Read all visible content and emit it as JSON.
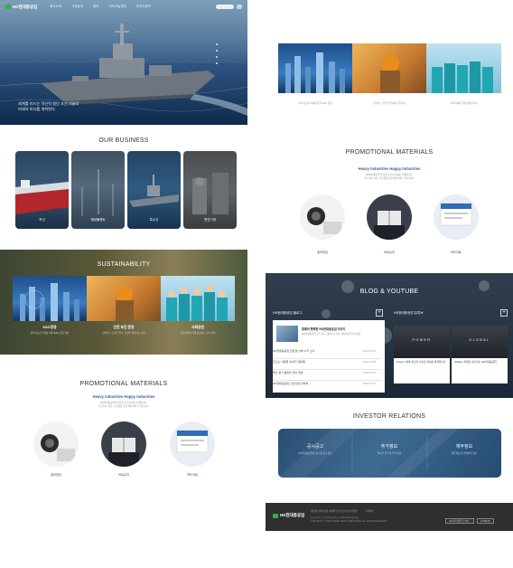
{
  "header": {
    "logo_text": "HD현대중공업",
    "menu": [
      "회사소개",
      "사업분야",
      "홍보",
      "지속가능경영",
      "투자자정보"
    ]
  },
  "hero": {
    "caption_line1": "세계를 리드는 혁신적 첨단 조선 기술로",
    "caption_line2": "미래의 바다를 개척한다"
  },
  "business": {
    "title": "OUR BUSINESS",
    "cards": [
      {
        "label": "조선"
      },
      {
        "label": "해양플랜트"
      },
      {
        "label": "특수선"
      },
      {
        "label": "엔진기계"
      }
    ]
  },
  "sustainability": {
    "title": "SUSTAINABILITY",
    "items": [
      {
        "title": "ESG경영",
        "desc": "지속가능한 미래를 위한 ESG 경영 실천"
      },
      {
        "title": "안전 보건 환경",
        "desc": "안전하고 건강한 일터, 환경을 생각하는 기업"
      },
      {
        "title": "사회공헌",
        "desc": "지역사회와 함께 성장하는 나눔 경영"
      }
    ]
  },
  "promotional": {
    "title": "PROMOTIONAL MATERIALS",
    "subtitle": "Heavy Industries Happy Industries",
    "desc_line1": "HD현대중공업의 다양한 홍보자료를 소개합니다.",
    "desc_line2": "브로슈어, 사보, 홍보영상 등을 확인하실 수 있습니다.",
    "items": [
      {
        "label": "홍보영상"
      },
      {
        "label": "브로슈어"
      },
      {
        "label": "보도자료"
      }
    ]
  },
  "right_top_images": {
    "captions": [
      "지속가능한 미래를 위한 ESG 경영",
      "안전하고 건강한 일터를 만듭니다",
      "지역사회와 함께 성장합니다"
    ]
  },
  "blog": {
    "title": "BLOG & YOUTUBE",
    "blog_head": "HD현대중공업 블로그",
    "youtube_head": "HD현대중공업 유튜브",
    "featured_title": "함께라 행복한 HD현대중공업 이야기",
    "featured_desc": "HD현대중공업 공식 블로그에서 더 많은 이야기를 만나보세요.",
    "news": [
      {
        "title": "HD현대중공업 친환경 선박 수주 소식",
        "date": "2024.03.12"
      },
      {
        "title": "조선소 사람들 이야기 세번째",
        "date": "2024.03.08"
      },
      {
        "title": "울산 본사 봄맞이 행사 현장",
        "date": "2024.03.02"
      },
      {
        "title": "HD현대중공업 신입사원 인터뷰",
        "date": "2024.02.27"
      }
    ],
    "videos": [
      {
        "thumb_word": "POWER",
        "title": "Power | 세계 최고의 기술로 바다를 개척합니다"
      },
      {
        "thumb_word": "GLOBAL",
        "title": "Global | 세계로 나아가는 HD현대중공업"
      }
    ]
  },
  "investor": {
    "title": "INVESTOR RELATIONS",
    "items": [
      {
        "title": "공시공고",
        "desc": "HD현대중공업의 공시 및 공고 정보"
      },
      {
        "title": "주가정보",
        "desc": "실시간 주가 및 주식 정보"
      },
      {
        "title": "재무정보",
        "desc": "재무제표 및 경영실적 정보"
      }
    ]
  },
  "footer": {
    "logo_text": "HD현대중공업",
    "links": [
      "개인정보처리방침",
      "이메일무단수집거부",
      "윤리경영",
      "고객센터"
    ],
    "address": "울산광역시 동구 방어진순환도로 1000 HD현대중공업",
    "copyright": "COPYRIGHT © HD HYUNDAI HEAVY INDUSTRIES. ALL RIGHTS RESERVED.",
    "btn_family": "HD현대 패밀리사이트",
    "btn_lang": "KOREAN"
  },
  "colors": {
    "accent": "#2db24a",
    "promo_blue": "#3b5aa8"
  }
}
